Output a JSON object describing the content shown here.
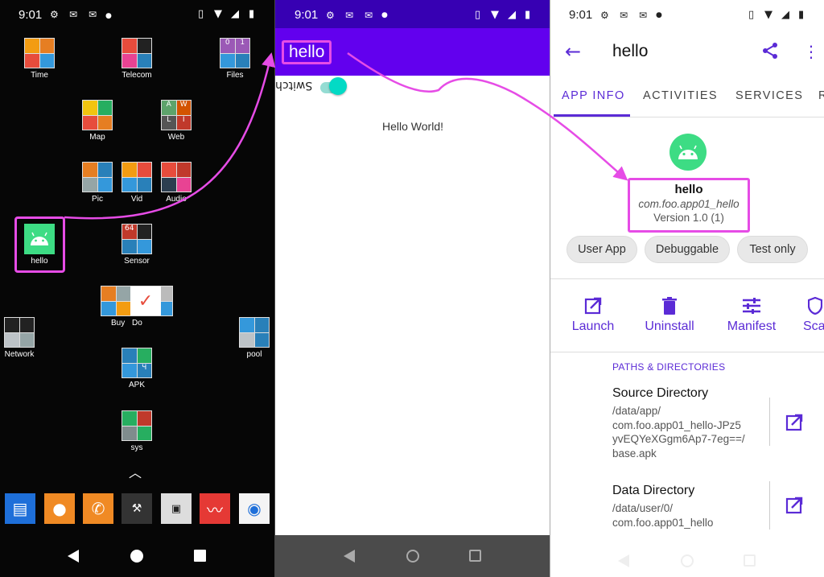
{
  "launcher": {
    "time": "9:01",
    "apps": {
      "time": "Time",
      "telecom": "Telecom",
      "files": "Files",
      "map": "Map",
      "web": "Web",
      "pic": "Pic",
      "vid": "Vid",
      "audio": "Audio",
      "hello": "hello",
      "sensor": "Sensor",
      "buy": "Buy",
      "do": "Do",
      "network": "Network",
      "pool": "pool",
      "apk": "APK",
      "sys": "sys"
    },
    "files_cells": [
      "0",
      "1"
    ],
    "web_cells": [
      "A",
      "W",
      "L",
      "I"
    ],
    "sensor_cell": "64",
    "apk_cell": "Ч"
  },
  "hello_app": {
    "time": "9:01",
    "title": "hello",
    "switch_label": "Switch",
    "message": "Hello World!"
  },
  "app_info": {
    "time": "9:01",
    "title": "hello",
    "tabs": [
      "APP INFO",
      "ACTIVITIES",
      "SERVICES",
      "R"
    ],
    "name": "hello",
    "package": "com.foo.app01_hello",
    "version": "Version 1.0 (1)",
    "chips": [
      "User App",
      "Debuggable",
      "Test only"
    ],
    "actions": [
      "Launch",
      "Uninstall",
      "Manifest",
      "Sca"
    ],
    "section_header": "PATHS & DIRECTORIES",
    "source_dir": {
      "title": "Source Directory",
      "value": "/data/app/\ncom.foo.app01_hello-JPz5\nyvEQYeXGgm6Ap7-7eg==/\nbase.apk"
    },
    "data_dir": {
      "title": "Data Directory",
      "value": "/data/user/0/\ncom.foo.app01_hello"
    }
  },
  "colors": {
    "accent": "#5b2bd6",
    "toolbar": "#6200ee",
    "statusbar": "#3700b3",
    "android_green": "#3ddc84",
    "highlight": "#e64ce6",
    "switch": "#03dac5"
  }
}
